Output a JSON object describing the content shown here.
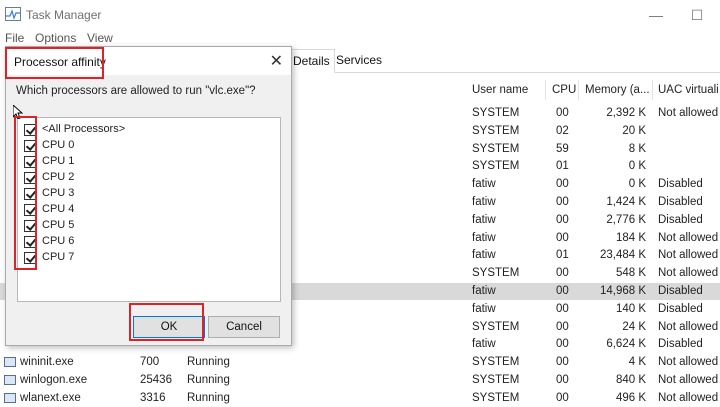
{
  "window": {
    "title": "Task Manager",
    "minimize": "—",
    "maximize": "☐"
  },
  "menu": [
    "File",
    "Options",
    "View"
  ],
  "tabs": [
    {
      "label": "Details",
      "active": true
    },
    {
      "label": "Services",
      "active": false
    }
  ],
  "columns": [
    "User name",
    "CPU",
    "Memory (a...",
    "UAC virtuali"
  ],
  "rows": [
    {
      "user": "SYSTEM",
      "cpu": "00",
      "mem": "2,392 K",
      "uac": "Not allowed"
    },
    {
      "user": "SYSTEM",
      "cpu": "02",
      "mem": "20 K",
      "uac": ""
    },
    {
      "user": "SYSTEM",
      "cpu": "59",
      "mem": "8 K",
      "uac": ""
    },
    {
      "user": "SYSTEM",
      "cpu": "01",
      "mem": "0 K",
      "uac": ""
    },
    {
      "user": "fatiw",
      "cpu": "00",
      "mem": "0 K",
      "uac": "Disabled"
    },
    {
      "user": "fatiw",
      "cpu": "00",
      "mem": "1,424 K",
      "uac": "Disabled"
    },
    {
      "user": "fatiw",
      "cpu": "00",
      "mem": "2,776 K",
      "uac": "Disabled"
    },
    {
      "user": "fatiw",
      "cpu": "00",
      "mem": "184 K",
      "uac": "Not allowed"
    },
    {
      "user": "fatiw",
      "cpu": "01",
      "mem": "23,484 K",
      "uac": "Not allowed"
    },
    {
      "user": "SYSTEM",
      "cpu": "00",
      "mem": "548 K",
      "uac": "Not allowed"
    },
    {
      "user": "fatiw",
      "cpu": "00",
      "mem": "14,968 K",
      "uac": "Disabled",
      "selected": true
    },
    {
      "user": "fatiw",
      "cpu": "00",
      "mem": "140 K",
      "uac": "Disabled"
    },
    {
      "user": "SYSTEM",
      "cpu": "00",
      "mem": "24 K",
      "uac": "Not allowed"
    },
    {
      "user": "fatiw",
      "cpu": "00",
      "mem": "6,624 K",
      "uac": "Disabled"
    },
    {
      "name": "wininit.exe",
      "pid": "700",
      "status": "Running",
      "user": "SYSTEM",
      "cpu": "00",
      "mem": "4 K",
      "uac": "Not allowed"
    },
    {
      "name": "winlogon.exe",
      "pid": "25436",
      "status": "Running",
      "user": "SYSTEM",
      "cpu": "00",
      "mem": "840 K",
      "uac": "Not allowed"
    },
    {
      "name": "wlanext.exe",
      "pid": "3316",
      "status": "Running",
      "user": "SYSTEM",
      "cpu": "00",
      "mem": "496 K",
      "uac": "Not allowed"
    }
  ],
  "dialog": {
    "title": "Processor affinity",
    "question": "Which processors are allowed to run \"vlc.exe\"?",
    "items": [
      {
        "label": "<All Processors>",
        "checked": true
      },
      {
        "label": "CPU 0",
        "checked": true
      },
      {
        "label": "CPU 1",
        "checked": true
      },
      {
        "label": "CPU 2",
        "checked": true
      },
      {
        "label": "CPU 3",
        "checked": true
      },
      {
        "label": "CPU 4",
        "checked": true
      },
      {
        "label": "CPU 5",
        "checked": true
      },
      {
        "label": "CPU 6",
        "checked": true
      },
      {
        "label": "CPU 7",
        "checked": true
      }
    ],
    "ok_label": "OK",
    "cancel_label": "Cancel"
  },
  "colors": {
    "highlight": "#d9242b",
    "selected_row": "#d9d9d9"
  }
}
